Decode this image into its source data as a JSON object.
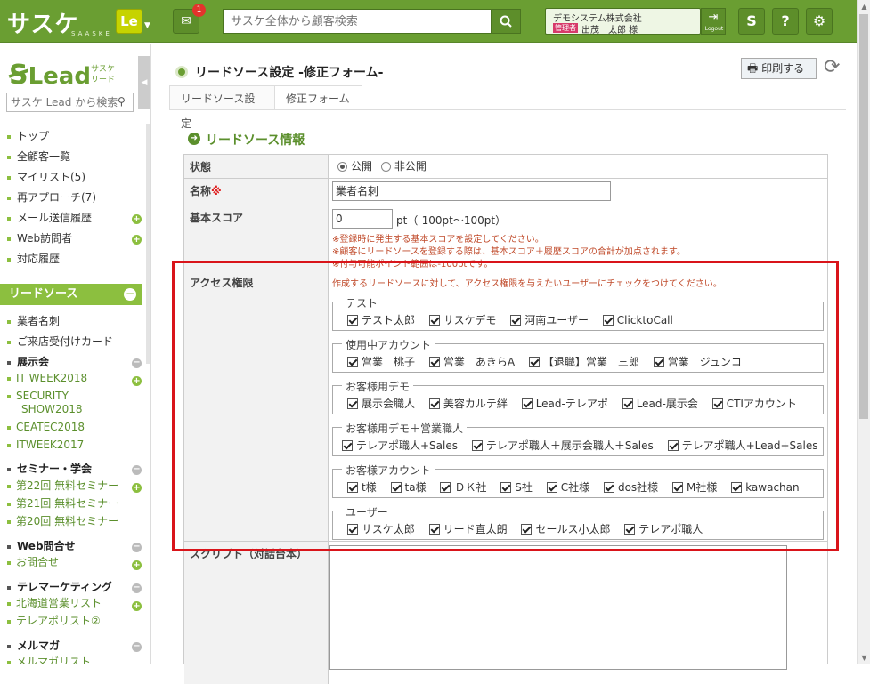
{
  "topbar": {
    "logo_text": "サスケ",
    "logo_sub": "SAASKE",
    "le_label": "Le",
    "msg_badge": "1",
    "search_placeholder": "サスケ全体から顧客検索",
    "user_company": "デモシステム株式会社",
    "user_role": "管理者",
    "user_name": "出茂　太郎 様",
    "logout_label": "Logout",
    "icon_s": "S",
    "icon_help": "?",
    "icon_gear": "⚙"
  },
  "sidebar": {
    "logo_text": "Lead",
    "logo_sub_1": "サスケ",
    "logo_sub_2": "リード",
    "search_placeholder": "サスケ Lead から検索",
    "nav": [
      {
        "label": "トップ"
      },
      {
        "label": "全顧客一覧"
      },
      {
        "label": "マイリスト(5)"
      },
      {
        "label": "再アプローチ(7)"
      },
      {
        "label": "メール送信履歴"
      },
      {
        "label": "Web訪問者"
      },
      {
        "label": "対応履歴"
      }
    ],
    "section_title": "リードソース",
    "lead_nav": [
      {
        "label": "業者名刺"
      },
      {
        "label": "ご来店受付けカード"
      }
    ],
    "groups": [
      {
        "title": "展示会",
        "items": [
          "IT WEEK2018",
          "SECURITY",
          "SHOW2018",
          "CEATEC2018",
          "ITWEEK2017"
        ]
      },
      {
        "title": "セミナー・学会",
        "items": [
          "第22回 無料セミナー",
          "第21回 無料セミナー",
          "第20回 無料セミナー"
        ]
      },
      {
        "title": "Web問合せ",
        "items": [
          "お問合せ"
        ]
      },
      {
        "title": "テレマーケティング",
        "items": [
          "北海道営業リスト",
          "テレアポリスト②"
        ]
      },
      {
        "title": "メルマガ",
        "items": [
          "メルマガリスト"
        ]
      }
    ]
  },
  "page": {
    "title": "リードソース設定 -修正フォーム-",
    "print_label": "印刷する",
    "breadcrumb": [
      "リードソース設定",
      "修正フォーム"
    ],
    "section_title": "リードソース情報"
  },
  "form": {
    "status_label": "状態",
    "status_options": [
      "公開",
      "非公開"
    ],
    "status_selected": "公開",
    "name_label": "名称",
    "name_required": "※",
    "name_value": "業者名刺",
    "score_label": "基本スコア",
    "score_value": "0",
    "score_unit": "pt（-100pt〜100pt）",
    "score_notes": [
      "※登録時に発生する基本スコアを設定してください。",
      "※顧客にリードソースを登録する際は、基本スコア＋履歴スコアの合計が加点されます。",
      "※付与可能ポイント範囲は-100ptです。"
    ],
    "access_label": "アクセス権限",
    "access_note": "作成するリードソースに対して、アクセス権限を与えたいユーザーにチェックをつけてください。",
    "groups": [
      {
        "name": "テスト",
        "users": [
          "テスト太郎",
          "サスケデモ",
          "河南ユーザー",
          "ClicktoCall"
        ]
      },
      {
        "name": "使用中アカウント",
        "users": [
          "営業　桃子",
          "営業　あきらA",
          "【退職】営業　三郎",
          "営業　ジュンコ"
        ]
      },
      {
        "name": "お客様用デモ",
        "users": [
          "展示会職人",
          "美容カルテ絆",
          "Lead-テレアポ",
          "Lead-展示会",
          "CTIアカウント"
        ]
      },
      {
        "name": "お客様用デモ＋営業職人",
        "users": [
          "テレアポ職人+Sales",
          "テレアポ職人＋展示会職人＋Sales",
          "テレアポ職人+Lead+Sales"
        ]
      },
      {
        "name": "お客様アカウント",
        "users": [
          "t様",
          "ta様",
          "ＤＫ社",
          "S社",
          "C社様",
          "dos社様",
          "M社様",
          "kawachan"
        ]
      },
      {
        "name": "ユーザー",
        "users": [
          "サスケ太郎",
          "リード直太朗",
          "セールス小太郎",
          "テレアポ職人"
        ]
      }
    ],
    "script_label": "スクリプト（対話台本）"
  }
}
